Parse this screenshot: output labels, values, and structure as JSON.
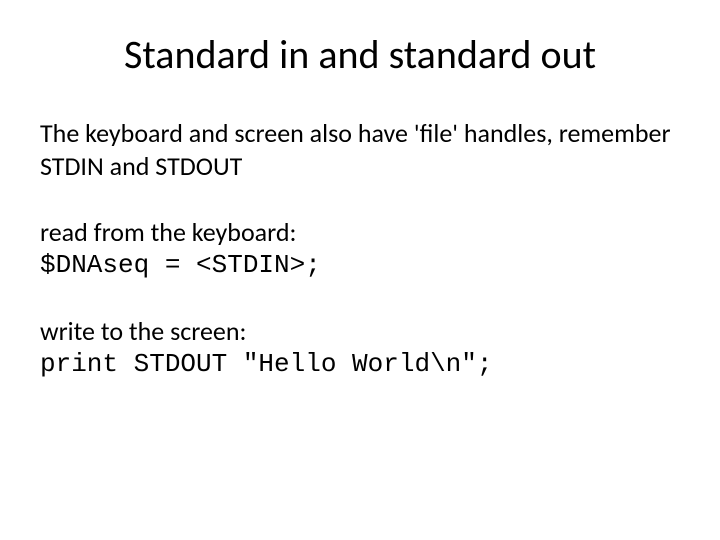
{
  "title": "Standard in and standard out",
  "intro": "The keyboard and screen also have 'file' handles, remember STDIN and STDOUT",
  "read_label": "read from the keyboard:",
  "read_code": "$DNAseq = <STDIN>;",
  "write_label": "write to the screen:",
  "write_code": "print STDOUT \"Hello World\\n\";"
}
